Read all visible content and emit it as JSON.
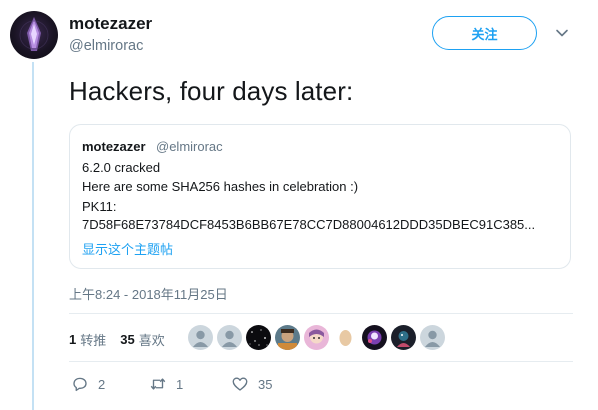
{
  "author": {
    "display_name": "motezazer",
    "handle": "@elmirorac"
  },
  "follow_button": {
    "label": "关注"
  },
  "tweet": {
    "text": "Hackers, four days later:",
    "timestamp": "上午8:24 - 2018年11月25日"
  },
  "quoted_tweet": {
    "display_name": "motezazer",
    "handle": "@elmirorac",
    "lines": [
      "6.2.0 cracked",
      "Here are some SHA256 hashes in celebration :)",
      "PK11:",
      "7D58F68E73784DCF8453B6BB67E78CC7D88004612DDD35DBEC91C385..."
    ],
    "show_thread": "显示这个主题帖"
  },
  "stats": {
    "retweets_count": "1",
    "retweets_label": "转推",
    "likes_count": "35",
    "likes_label": "喜欢"
  },
  "liker_avatars": [
    "default-avatar",
    "default-avatar",
    "starfield-avatar",
    "photo-avatar",
    "pink-avatar",
    "egg-avatar",
    "purple-avatar",
    "dark-avatar",
    "default-avatar"
  ],
  "actions": {
    "reply_count": "2",
    "retweet_count": "1",
    "like_count": "35"
  },
  "colors": {
    "accent": "#1da1f2",
    "secondary_text": "#657786",
    "thread_line": "#c4e1f4"
  }
}
